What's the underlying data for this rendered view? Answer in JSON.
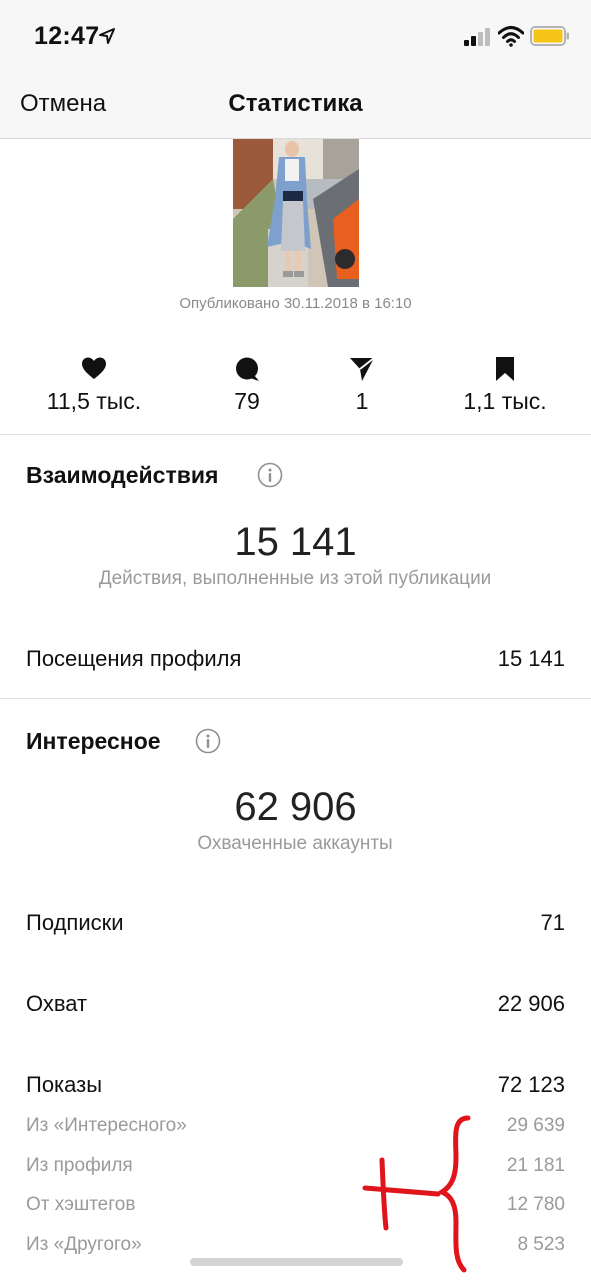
{
  "status_bar": {
    "time": "12:47",
    "icons": [
      "location-arrow-icon",
      "signal-icon",
      "wifi-icon",
      "battery-icon"
    ],
    "battery_color": "#f5c518"
  },
  "nav": {
    "cancel_label": "Отмена",
    "title": "Статистика"
  },
  "post": {
    "published": "Опубликовано 30.11.2018 в 16:10"
  },
  "stats": {
    "likes": "11,5 тыс.",
    "comments": "79",
    "shares": "1",
    "saves": "1,1 тыс."
  },
  "interactions": {
    "title": "Взаимодействия",
    "total": "15 141",
    "caption": "Действия, выполненные из этой публикации",
    "rows": [
      {
        "label": "Посещения профиля",
        "value": "15 141"
      }
    ]
  },
  "discovery": {
    "title": "Интересное",
    "total": "62 906",
    "caption": "Охваченные аккаунты",
    "rows": [
      {
        "label": "Подписки",
        "value": "71"
      },
      {
        "label": "Охват",
        "value": "22 906"
      },
      {
        "label": "Показы",
        "value": "72 123"
      }
    ],
    "impressions_breakdown": [
      {
        "label": "Из «Интересного»",
        "value": "29 639"
      },
      {
        "label": "Из профиля",
        "value": "21 181"
      },
      {
        "label": "От хэштегов",
        "value": "12 780"
      },
      {
        "label": "Из «Другого»",
        "value": "8 523"
      }
    ]
  },
  "colors": {
    "annotation": "#e0141b",
    "secondary_text": "#9a9a9a"
  }
}
